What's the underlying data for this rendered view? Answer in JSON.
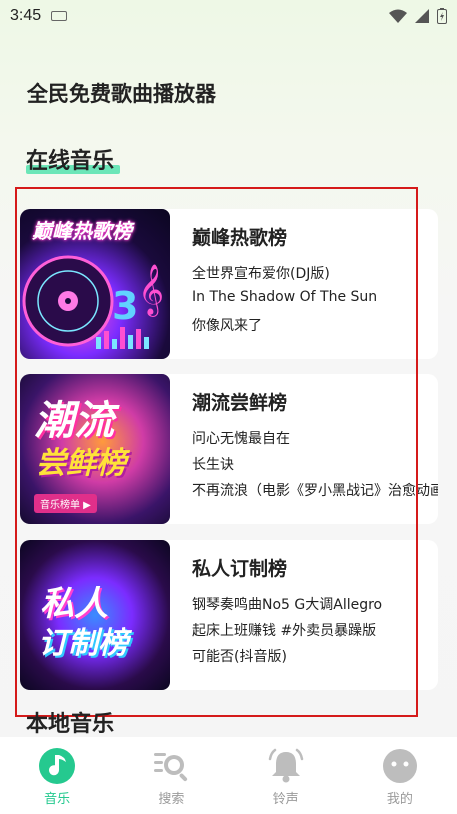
{
  "status": {
    "time": "3:45"
  },
  "app": {
    "title": "全民免费歌曲播放器"
  },
  "section": {
    "title": "在线音乐",
    "next_title": "本地音乐"
  },
  "charts": [
    {
      "title": "巅峰热歌榜",
      "cover_text": "巅峰热歌榜",
      "songs": [
        "全世界宣布爱你(DJ版)",
        "In The Shadow Of The Sun",
        "你像风来了"
      ]
    },
    {
      "title": "潮流尝鲜榜",
      "cover_text_1": "潮流",
      "cover_text_2": "尝鲜榜",
      "cover_tag": "音乐榜单 ▶",
      "songs": [
        "问心无愧最自在",
        "长生诀",
        "不再流浪（电影《罗小黑战记》治愈动画曲"
      ]
    },
    {
      "title": "私人订制榜",
      "cover_text_1": "私人",
      "cover_text_2": "订制榜",
      "songs": [
        "钢琴奏鸣曲No5 G大调Allegro",
        "起床上班赚钱 #外卖员暴躁版",
        "可能否(抖音版)"
      ]
    }
  ],
  "nav": {
    "items": [
      {
        "label": "音乐",
        "icon": "music-note-icon",
        "active": true
      },
      {
        "label": "搜索",
        "icon": "search-icon",
        "active": false
      },
      {
        "label": "铃声",
        "icon": "bell-icon",
        "active": false
      },
      {
        "label": "我的",
        "icon": "profile-face-icon",
        "active": false
      }
    ]
  },
  "colors": {
    "accent": "#25c98f",
    "highlight_box": "#d51a1a"
  }
}
